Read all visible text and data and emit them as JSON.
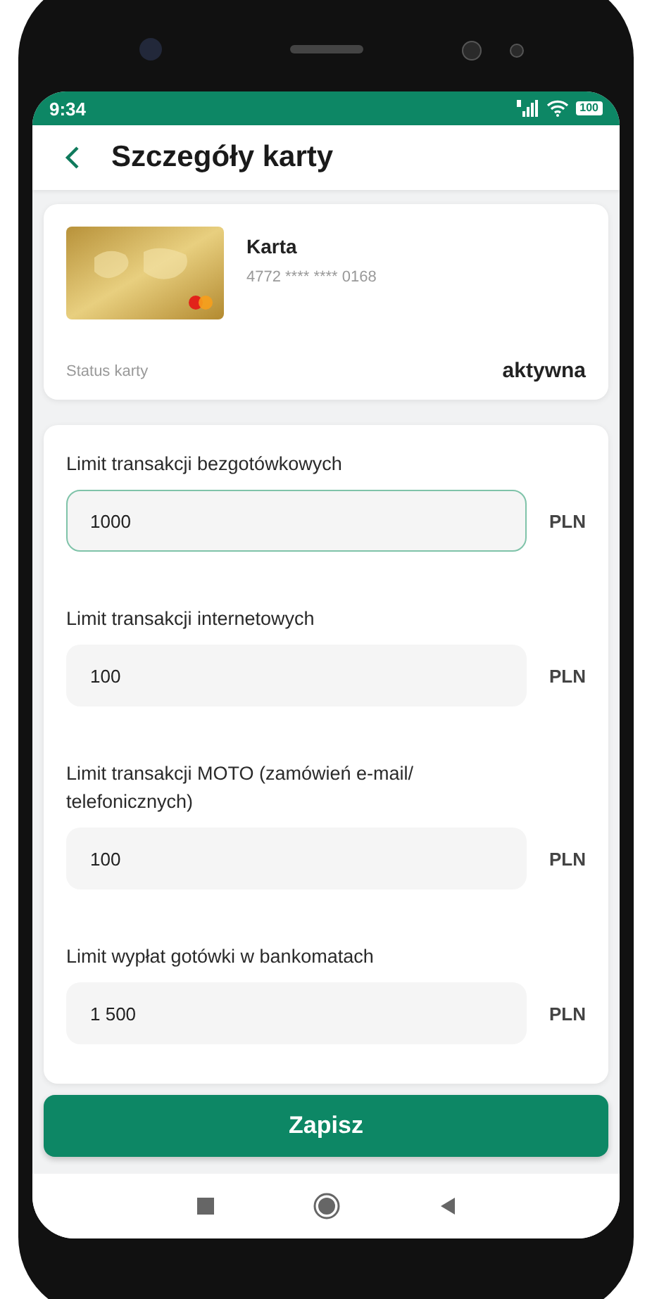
{
  "status_bar": {
    "time": "9:34",
    "battery": "100"
  },
  "header": {
    "title": "Szczegóły karty"
  },
  "card": {
    "name": "Karta",
    "number": "4772 **** **** 0168",
    "status_label": "Status karty",
    "status_value": "aktywna"
  },
  "limits": [
    {
      "label": "Limit transakcji bezgotówkowych",
      "value": "1000",
      "currency": "PLN",
      "focused": true
    },
    {
      "label": "Limit transakcji internetowych",
      "value": "100",
      "currency": "PLN",
      "focused": false
    },
    {
      "label": "Limit transakcji MOTO (zamówień e-mail/ telefonicznych)",
      "value": "100",
      "currency": "PLN",
      "focused": false
    },
    {
      "label": "Limit wypłat gotówki w bankomatach",
      "value": "1 500",
      "currency": "PLN",
      "focused": false
    }
  ],
  "save_button": "Zapisz"
}
